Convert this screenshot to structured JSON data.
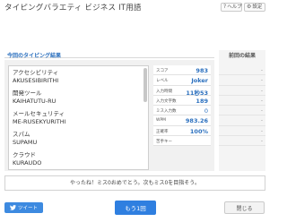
{
  "window": {
    "title": "タイピングバラエティ ビジネス IT用語",
    "help_label": "ヘルプ",
    "settings_label": "設定"
  },
  "results": {
    "heading": "今回のタイピング結果",
    "previous_heading": "前回の結果"
  },
  "words": [
    {
      "jp": "アクセシビリティ",
      "romaji": "AKUSESIBIRITHI"
    },
    {
      "jp": "開発ツール",
      "romaji": "KAIHATUTU-RU"
    },
    {
      "jp": "メールセキュリティ",
      "romaji": "ME-RUSEKYURITHI"
    },
    {
      "jp": "スパム",
      "romaji": "SUPAMU"
    },
    {
      "jp": "クラウド",
      "romaji": "KURAUDO"
    }
  ],
  "stats": [
    {
      "label": "スコア",
      "value": "983",
      "previous": "-"
    },
    {
      "label": "レベル",
      "value": "Joker",
      "previous": "-"
    },
    {
      "label": "入力時間",
      "value": "11秒53",
      "previous": "-"
    },
    {
      "label": "入力文字数",
      "value": "189",
      "previous": "-"
    },
    {
      "label": "ミス入力数",
      "value": "0",
      "previous": "-"
    },
    {
      "label": "WPM",
      "value": "983.26",
      "previous": "-"
    },
    {
      "label": "正確率",
      "value": "100%",
      "previous": "-"
    },
    {
      "label": "苦手キー",
      "value": "",
      "previous": "-"
    }
  ],
  "message": "やったね！ミス0おめでとう。次もミス0を目指そう。",
  "buttons": {
    "tweet": "ツイート",
    "again": "もう1回",
    "close": "閉じる"
  },
  "colors": {
    "accent": "#2f7fe0",
    "tweet": "#3d8ae0",
    "value_text": "#2a6fbe"
  }
}
